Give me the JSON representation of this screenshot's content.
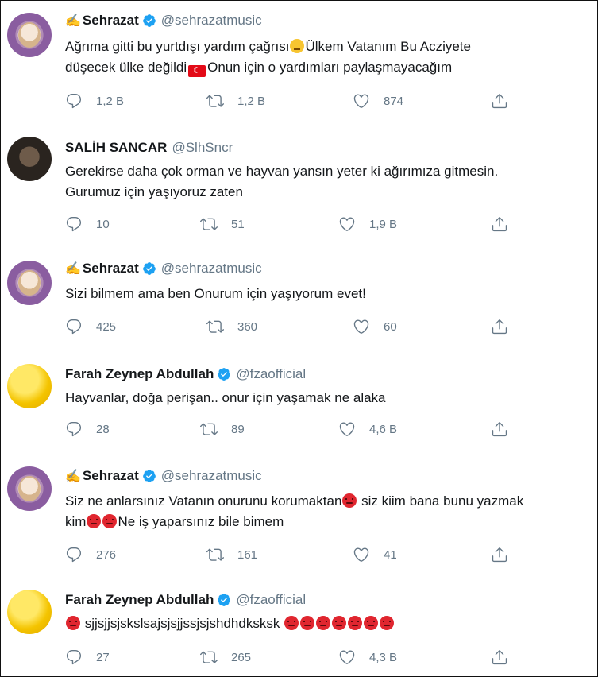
{
  "tweets": [
    {
      "avatar": "sehrazat-avatar",
      "name": "Sehrazat",
      "name_prefix_icon": "writing-hand-icon",
      "verified": true,
      "handle": "@sehrazatmusic",
      "text_parts": [
        "Ağrıma gitti bu yurtdışı yardım çağrısı",
        "Ülkem Vatanım Bu Acziyete",
        "düşecek ülke değildi",
        "Onun için o yardımları paylaşmayacağım"
      ],
      "replies": "1,2 B",
      "retweets": "1,2 B",
      "likes": "874"
    },
    {
      "avatar": "salih-avatar",
      "name": "SALİH SANCAR",
      "verified": false,
      "handle": "@SlhSncr",
      "text_parts": [
        "Gerekirse daha çok orman ve hayvan yansın yeter ki ağırımıza gitmesin.",
        "Gurumuz için yaşıyoruz zaten"
      ],
      "replies": "10",
      "retweets": "51",
      "likes": "1,9 B"
    },
    {
      "avatar": "sehrazat-avatar",
      "name": "Sehrazat",
      "name_prefix_icon": "writing-hand-icon",
      "verified": true,
      "handle": "@sehrazatmusic",
      "text_parts": [
        "Sizi bilmem ama ben Onurum için yaşıyorum evet!"
      ],
      "replies": "425",
      "retweets": "360",
      "likes": "60"
    },
    {
      "avatar": "farah-avatar",
      "name": "Farah Zeynep Abdullah",
      "verified": true,
      "handle": "@fzaofficial",
      "text_parts": [
        "Hayvanlar, doğa perişan.. onur için yaşamak ne alaka"
      ],
      "replies": "28",
      "retweets": "89",
      "likes": "4,6 B"
    },
    {
      "avatar": "sehrazat-avatar",
      "name": "Sehrazat",
      "name_prefix_icon": "writing-hand-icon",
      "verified": true,
      "handle": "@sehrazatmusic",
      "text_parts": [
        "Siz ne anlarsınız Vatanın onurunu korumaktan",
        " siz kiim bana bunu yazmak",
        "kim",
        "Ne iş yaparsınız bile bimem"
      ],
      "replies": "276",
      "retweets": "161",
      "likes": "41"
    },
    {
      "avatar": "farah-avatar",
      "name": "Farah Zeynep Abdullah",
      "verified": true,
      "handle": "@fzaofficial",
      "text_parts": [
        "sjjsjjsjskslsajsjsjjssjsjshdhdksksk"
      ],
      "replies": "27",
      "retweets": "265",
      "likes": "4,3 B"
    }
  ],
  "colors": {
    "text": "#14171a",
    "secondary": "#657786",
    "verified": "#1da1f2",
    "angry_emoji": "#e0262f",
    "flag": "#e30a17"
  },
  "icons": [
    "reply-icon",
    "retweet-icon",
    "like-icon",
    "share-icon",
    "verified-badge-icon",
    "angry-face-emoji",
    "unamused-face-emoji",
    "turkey-flag-emoji"
  ]
}
